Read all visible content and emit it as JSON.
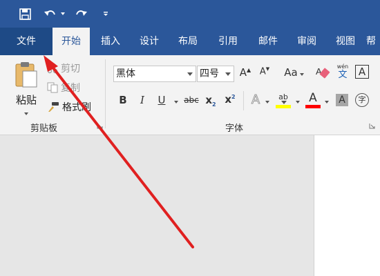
{
  "quick_access": {
    "icons": [
      "save-icon",
      "undo-icon",
      "redo-icon",
      "customize-icon"
    ]
  },
  "tabs": [
    {
      "label": "文件"
    },
    {
      "label": "开始"
    },
    {
      "label": "插入"
    },
    {
      "label": "设计"
    },
    {
      "label": "布局"
    },
    {
      "label": "引用"
    },
    {
      "label": "邮件"
    },
    {
      "label": "审阅"
    },
    {
      "label": "视图"
    },
    {
      "label": "帮"
    }
  ],
  "clipboard": {
    "paste_label": "粘贴",
    "cut_label": "剪切",
    "copy_label": "复制",
    "format_painter_label": "格式刷",
    "group_label": "剪贴板"
  },
  "font": {
    "font_name": "黑体",
    "font_size": "四号",
    "group_label": "字体",
    "phonetic_top": "wén",
    "phonetic_bottom": "文",
    "char_border": "A",
    "enclose_char": "字"
  },
  "colors": {
    "accent": "#2b579a",
    "highlight": "#ffff00",
    "font_color": "#ff0000",
    "arrow": "#e02020"
  }
}
